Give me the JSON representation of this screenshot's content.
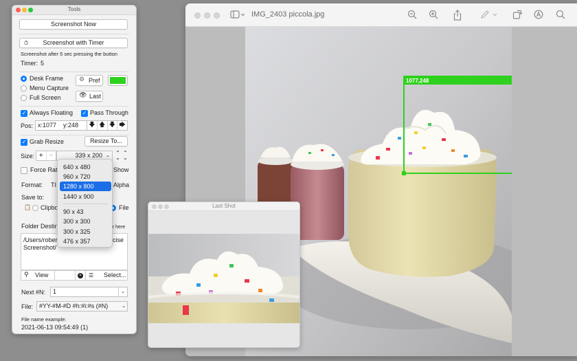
{
  "viewer": {
    "title": "IMG_2403 piccola.jpg",
    "toolbar_icons": [
      "sidebar-icon",
      "zoom-out-icon",
      "zoom-in-icon",
      "share-icon",
      "markup-icon",
      "rotate-icon",
      "annotate-icon",
      "search-icon"
    ]
  },
  "selection": {
    "position_label": "1077,248",
    "size_label": "339x200",
    "color": "#2ed11d"
  },
  "tools": {
    "title": "Tools",
    "screenshot_now": "Screenshot Now",
    "screenshot_timer": "Screenshot with Timer",
    "timer_hint": "Screenshot after 5 sec pressing the button",
    "timer_label": "Timer:",
    "timer_value": "5",
    "modes": [
      "Desk Frame",
      "Menu Capture",
      "Full Screen"
    ],
    "selected_mode": "Desk Frame",
    "pref_button": "Pref",
    "last_button": "Last",
    "frame_color": "#2ed11d",
    "always_floating": "Always Floating",
    "pass_through": "Pass Through",
    "pos_label": "Pos:",
    "pos_x": "x:1077",
    "pos_y": "y:248",
    "grab_resize": "Grab Resize",
    "resize_to": "Resize To...",
    "size_label": "Size:",
    "size_value": "339 x 200",
    "force_ratio": "Force Rat",
    "show_label": "Show",
    "format_label": "Format:",
    "format_value": "TI",
    "alpha_label": "Alpha",
    "save_to": "Save to:",
    "clipboard": "Clipbo",
    "file_label": "File",
    "folder_dest": "Folder Destin",
    "folder_hint": "er here",
    "folder_path_1": "/Users/rober",
    "folder_path_1b": "ecise",
    "folder_path_2": "Screenshot/",
    "view_button": "View",
    "select_button": "Select...",
    "next_label": "Next #N:",
    "next_value": "1",
    "file_pattern_label": "File:",
    "file_pattern": "#YY-#M-#D #h:#i:#s (#N)",
    "example_label": "File name example:",
    "example_value": "2021-06-13 09:54:49 (1)"
  },
  "dropdown": {
    "items": [
      "640 x 480",
      "960 x 720",
      "1280 x 800",
      "1440 x 900",
      "90 x 43",
      "300 x 300",
      "300 x 325",
      "476 x 357"
    ],
    "selected": "1280 x 800"
  },
  "lastshot": {
    "title": "Last Shot"
  }
}
